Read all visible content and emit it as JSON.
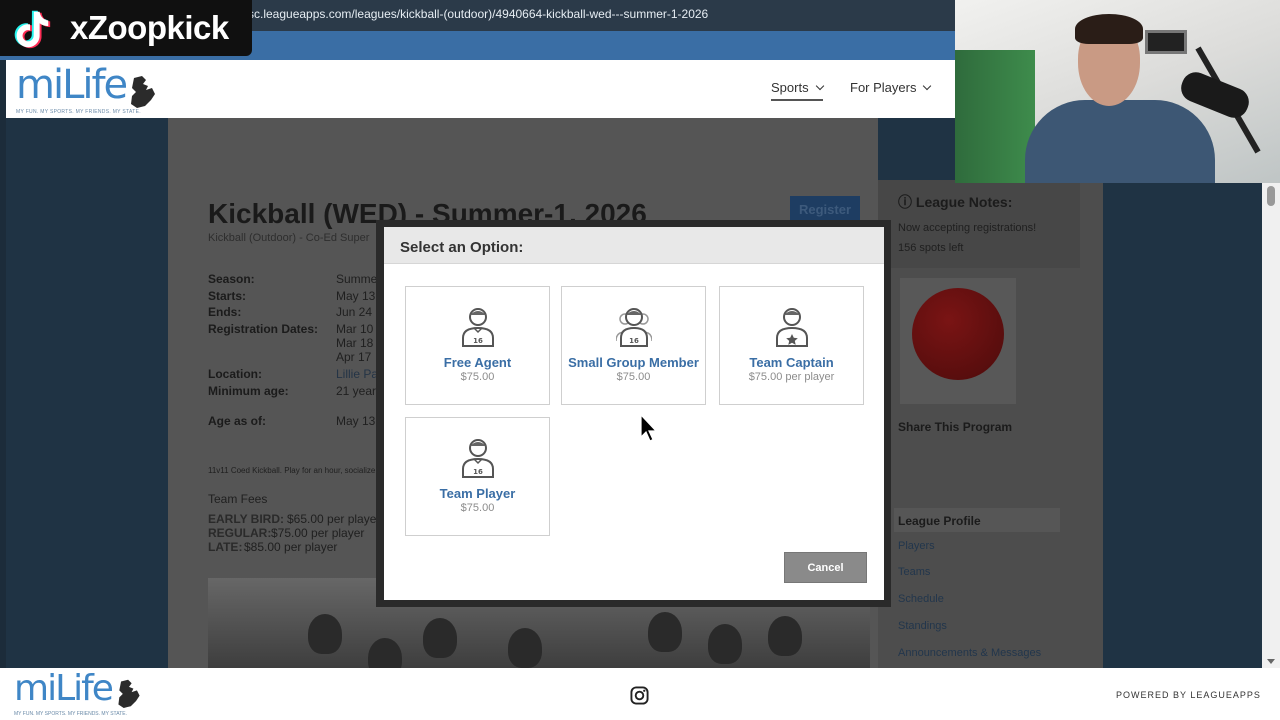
{
  "browser": {
    "url": "sc.leagueapps.com/leagues/kickball-(outdoor)/4940664-kickball-wed---summer-1-2026"
  },
  "overlay": {
    "tiktok_handle": "xZoopkick"
  },
  "site": {
    "logo_text": "miLife",
    "logo_tagline": "MY FUN. MY SPORTS. MY FRIENDS. MY STATE.",
    "nav": [
      {
        "label": "Sports"
      },
      {
        "label": "For Players"
      }
    ]
  },
  "league": {
    "title": "Kickball (WED) - Summer-1, 2026",
    "subtitle": "Kickball (Outdoor) - Co-Ed Super",
    "register_label": "Register",
    "details": [
      {
        "label": "Season:",
        "value": "Summer"
      },
      {
        "label": "Starts:",
        "value": "May 13"
      },
      {
        "label": "Ends:",
        "value": "Jun 24"
      },
      {
        "label": "Registration Dates:",
        "value": "Mar 10"
      },
      {
        "label": "",
        "value": "Mar 18"
      },
      {
        "label": "",
        "value": "Apr 17"
      },
      {
        "label": "Location:",
        "value": "Lillie Pa"
      },
      {
        "label": "Minimum age:",
        "value": "21 years"
      },
      {
        "label": "Age as of:",
        "value": "May 13"
      }
    ],
    "description": "11v11 Coed Kickball. Play for an hour, socialize",
    "fees_title": "Team Fees",
    "fees": [
      {
        "tier": "EARLY BIRD:",
        "amount": "$65.00 per player"
      },
      {
        "tier": "REGULAR:",
        "amount": "$75.00 per player"
      },
      {
        "tier": "LATE:",
        "amount": "$85.00 per player"
      }
    ]
  },
  "sidebar": {
    "notes_title": "League Notes:",
    "notes": [
      "Now accepting registrations!",
      "156 spots left"
    ],
    "share_label": "Share This Program",
    "profile_title": "League Profile",
    "links": [
      "Players",
      "Teams",
      "Schedule",
      "Standings",
      "Announcements & Messages"
    ]
  },
  "modal": {
    "title": "Select an Option:",
    "options": [
      {
        "label": "Free Agent",
        "price": "$75.00"
      },
      {
        "label": "Small Group Member",
        "price": "$75.00"
      },
      {
        "label": "Team Captain",
        "price": "$75.00 per player"
      },
      {
        "label": "Team Player",
        "price": "$75.00"
      }
    ],
    "cancel_label": "Cancel"
  },
  "footer": {
    "logo_text": "miLife",
    "logo_tagline": "MY FUN. MY SPORTS. MY FRIENDS. MY STATE.",
    "powered_by": "POWERED BY LEAGUEAPPS"
  },
  "colors": {
    "brand_blue": "#3f86c6",
    "option_link": "#3a6ea5",
    "cancel_gray": "#8a8a8a"
  }
}
